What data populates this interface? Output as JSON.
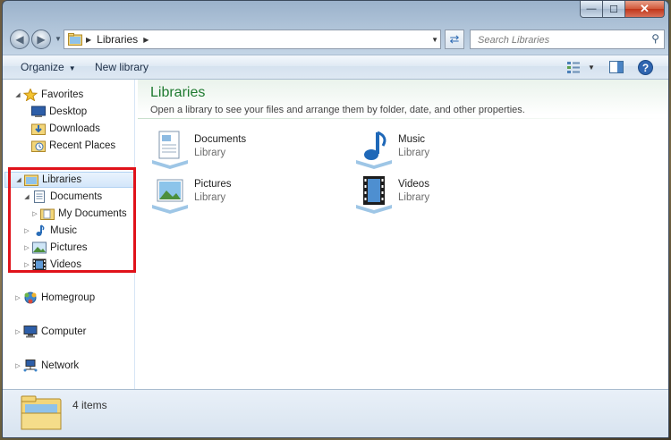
{
  "window": {
    "caption_min": "—",
    "caption_max": "☐",
    "caption_close": "✕"
  },
  "nav": {
    "back_icon": "◀",
    "forward_icon": "▶",
    "address_crumb": "Libraries",
    "search_placeholder": "Search Libraries"
  },
  "toolbar": {
    "organize_label": "Organize",
    "new_library_label": "New library"
  },
  "sidebar": {
    "favorites": {
      "label": "Favorites",
      "items": [
        {
          "label": "Desktop",
          "icon": "desktop-icon"
        },
        {
          "label": "Downloads",
          "icon": "downloads-icon"
        },
        {
          "label": "Recent Places",
          "icon": "recent-places-icon"
        }
      ]
    },
    "libraries": {
      "label": "Libraries",
      "documents": {
        "label": "Documents",
        "child": "My Documents"
      },
      "items": [
        {
          "label": "Music",
          "icon": "music-icon"
        },
        {
          "label": "Pictures",
          "icon": "pictures-icon"
        },
        {
          "label": "Videos",
          "icon": "videos-icon"
        }
      ]
    },
    "homegroup": "Homegroup",
    "computer": "Computer",
    "network": "Network"
  },
  "main": {
    "title": "Libraries",
    "subtitle": "Open a library to see your files and arrange them by folder, date, and other properties.",
    "libraries": [
      {
        "name": "Documents",
        "kind": "Library",
        "icon": "documents-library-icon"
      },
      {
        "name": "Music",
        "kind": "Library",
        "icon": "music-library-icon"
      },
      {
        "name": "Pictures",
        "kind": "Library",
        "icon": "pictures-library-icon"
      },
      {
        "name": "Videos",
        "kind": "Library",
        "icon": "videos-library-icon"
      }
    ]
  },
  "status": {
    "item_count": "4 items"
  },
  "colors": {
    "title_green": "#1e7a2f",
    "highlight_red": "#e0121a",
    "selection_blue": "#d3e6fa"
  }
}
